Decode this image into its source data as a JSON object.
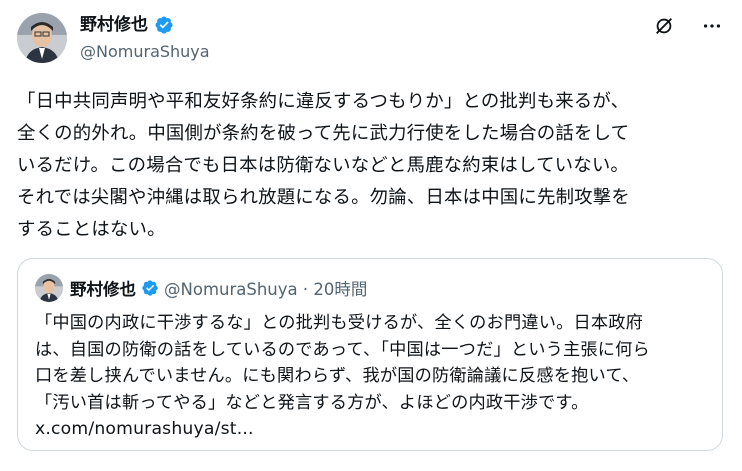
{
  "author": {
    "name": "野村修也",
    "handle": "@NomuraShuya"
  },
  "icons": {
    "verified": "verified-badge-icon",
    "grok": "grok-slash-icon",
    "more": "more-horizontal-icon"
  },
  "colors": {
    "verified": "#1d9bf0",
    "text": "#0f1419",
    "secondary": "#536471",
    "border": "#cfd9de"
  },
  "tweet": {
    "lines": [
      "「日中共同声明や平和友好条約に違反するつもりか」との批判も来るが、",
      "全くの的外れ。中国側が条約を破って先に武力行使をした場合の話をして",
      "いるだけ。この場合でも日本は防衛ないなどと馬鹿な約束はしていない。",
      "それでは尖閣や沖縄は取られ放題になる。勿論、日本は中国に先制攻撃を",
      "することはない。"
    ]
  },
  "quote": {
    "name": "野村修也",
    "handle_time": "@NomuraShuya · 20時間",
    "lines": [
      "「中国の内政に干渉するな」との批判も受けるが、全くのお門違い。日本政府",
      "は、自国の防衛の話をしているのであって、「中国は一つだ」という主張に何ら",
      "口を差し挟んでいません。にも関わらず、我が国の防衛論議に反感を抱いて、",
      "「汚い首は斬ってやる」などと発言する方が、よほどの内政干渉です。"
    ],
    "link": "x.com/nomurashuya/st..."
  }
}
